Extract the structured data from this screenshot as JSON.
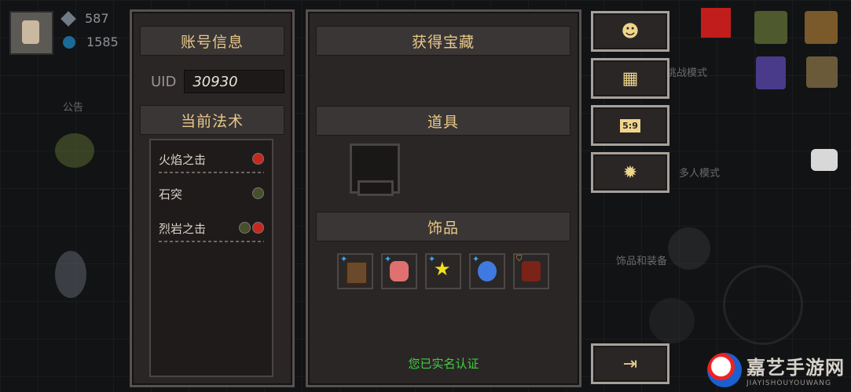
{
  "hud": {
    "gems": "587",
    "coins": "1585",
    "announcement_label": "公告"
  },
  "background_labels": {
    "challenge_mode": "挑战模式",
    "multiplayer_mode": "多人模式",
    "accessories_gear": "饰品和装备"
  },
  "account": {
    "title": "账号信息",
    "uid_label": "UID",
    "uid_value": "30930"
  },
  "spells": {
    "title": "当前法术",
    "items": [
      {
        "name": "火焰之击",
        "elements": [
          "fire"
        ]
      },
      {
        "name": "石突",
        "elements": [
          "earth"
        ]
      },
      {
        "name": "烈岩之击",
        "elements": [
          "earth",
          "fire"
        ]
      }
    ]
  },
  "treasure": {
    "title": "获得宝藏",
    "props_title": "道具",
    "accessories_title": "饰品",
    "accessories": [
      {
        "icon": "book-icon",
        "starred": true
      },
      {
        "icon": "meat-icon",
        "starred": true
      },
      {
        "icon": "star-icon",
        "starred": true
      },
      {
        "icon": "blue-gem-icon",
        "starred": true
      },
      {
        "icon": "potion-icon",
        "starred": false,
        "shield": true
      }
    ],
    "verified_text": "您已实名认证"
  },
  "side_buttons": [
    {
      "name": "customer-service-button",
      "icon": "headset-icon"
    },
    {
      "name": "gift-button",
      "icon": "gift-icon"
    },
    {
      "name": "ticket-button",
      "icon": "ticket-icon",
      "text": "5:9"
    },
    {
      "name": "settings-button",
      "icon": "gear-icon"
    },
    {
      "name": "logout-button",
      "icon": "exit-icon"
    }
  ],
  "watermark": {
    "title": "嘉艺手游网",
    "subtitle": "JIAYISHOUYOUWANG"
  },
  "colors": {
    "panel_bg": "#2a2626",
    "panel_border": "#58514e",
    "header_text": "#e8c88a",
    "verified_green": "#3fd03f",
    "fire_red": "#c7281d"
  }
}
